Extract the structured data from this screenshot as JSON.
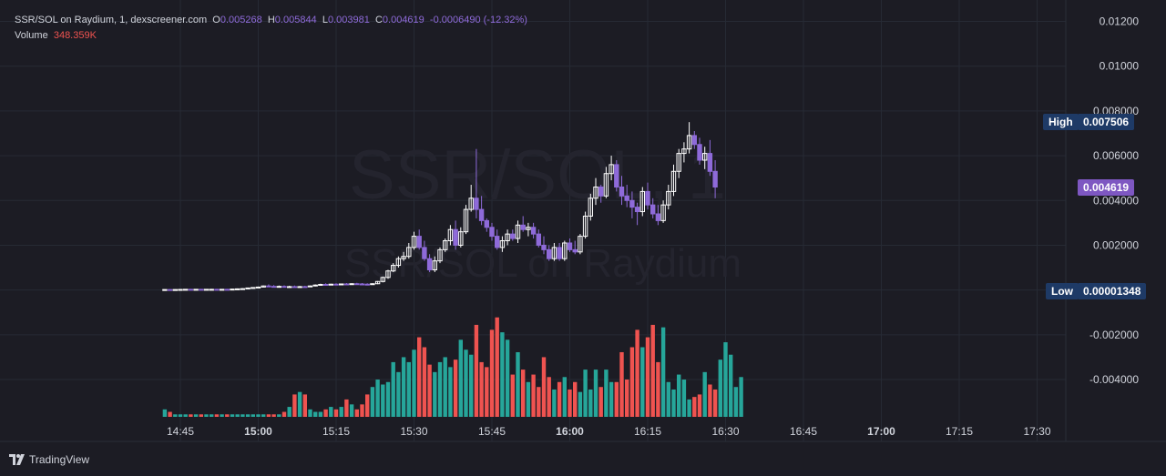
{
  "header": {
    "symbol": "SSR/SOL on Raydium, 1, dexscreener.com",
    "open_key": "O",
    "open": "0.005268",
    "high_key": "H",
    "high": "0.005844",
    "low_key": "L",
    "low": "0.003981",
    "close_key": "C",
    "close": "0.004619",
    "change": "-0.0006490 (-12.32%)",
    "volume_label": "Volume",
    "volume": "348.359K"
  },
  "watermark": {
    "line1": "SSR/SOL, 1",
    "line2": "SSR/SOL on Raydium"
  },
  "tags": {
    "high_label": "High",
    "high_value": "0.007506",
    "low_label": "Low",
    "low_value": "0.00001348",
    "last_value": "0.004619"
  },
  "branding": {
    "name": "TradingView"
  },
  "colors": {
    "background": "#1c1c24",
    "up_candle": "#ffffff",
    "down_candle": "#8e6ad9",
    "volume_up": "#26a69a",
    "volume_down": "#ef5350",
    "last_price_tag": "#7e57c2",
    "high_low_tag": "#1e3a66"
  },
  "chart_data": {
    "type": "candlestick",
    "price_axis": {
      "tick_labels": [
        "0.01200",
        "0.01000",
        "0.008000",
        "0.006000",
        "0.004000",
        "0.002000",
        "-0.002000",
        "-0.004000"
      ],
      "tick_values": [
        0.012,
        0.01,
        0.008,
        0.006,
        0.004,
        0.002,
        -0.002,
        -0.004
      ],
      "range": [
        -0.0057,
        0.0126
      ]
    },
    "time_axis": {
      "tick_labels": [
        "14:45",
        "15:00",
        "15:15",
        "15:30",
        "15:45",
        "16:00",
        "16:15",
        "16:30",
        "16:45",
        "17:00",
        "17:15",
        "17:30"
      ],
      "bold_labels": [
        "15:00",
        "16:00",
        "17:00"
      ],
      "start_minute": 882,
      "minutes_per_candle": 1
    },
    "candles_ohlc": [
      [
        1.35e-05,
        2.5e-05,
        1.35e-05,
        2e-05
      ],
      [
        2e-05,
        3.5e-05,
        1e-05,
        1.5e-05
      ],
      [
        1.5e-05,
        3e-05,
        1e-05,
        2e-05
      ],
      [
        2e-05,
        4e-05,
        1.5e-05,
        2.5e-05
      ],
      [
        2.5e-05,
        4e-05,
        2e-05,
        3e-05
      ],
      [
        3e-05,
        5e-05,
        2e-05,
        2e-05
      ],
      [
        2e-05,
        4e-05,
        1.5e-05,
        3e-05
      ],
      [
        3e-05,
        5e-05,
        2e-05,
        2e-05
      ],
      [
        2e-05,
        4e-05,
        1.5e-05,
        3e-05
      ],
      [
        3e-05,
        5e-05,
        2e-05,
        3e-05
      ],
      [
        3e-05,
        5e-05,
        2e-05,
        2e-05
      ],
      [
        2e-05,
        4e-05,
        1.5e-05,
        3e-05
      ],
      [
        3e-05,
        5e-05,
        2e-05,
        2e-05
      ],
      [
        2e-05,
        5e-05,
        1.5e-05,
        4e-05
      ],
      [
        4e-05,
        7e-05,
        3e-05,
        5e-05
      ],
      [
        5e-05,
        8e-05,
        4e-05,
        6e-05
      ],
      [
        6e-05,
        0.0001,
        5e-05,
        9e-05
      ],
      [
        9e-05,
        0.00012,
        8e-05,
        0.00011
      ],
      [
        0.00011,
        0.00015,
        0.0001,
        0.00013
      ],
      [
        0.00013,
        0.0002,
        0.00012,
        0.00018
      ],
      [
        0.00018,
        0.00025,
        0.00014,
        0.00016
      ],
      [
        0.00016,
        0.00022,
        0.00014,
        0.00015
      ],
      [
        0.00015,
        0.0002,
        0.00013,
        0.00016
      ],
      [
        0.00016,
        0.00021,
        0.00014,
        0.00014
      ],
      [
        0.00014,
        0.00019,
        0.00012,
        0.00015
      ],
      [
        0.00015,
        0.0002,
        0.00013,
        0.00014
      ],
      [
        0.00014,
        0.00018,
        0.00012,
        0.00015
      ],
      [
        0.00015,
        0.00019,
        0.00013,
        0.00014
      ],
      [
        0.00014,
        0.0002,
        0.00013,
        0.00018
      ],
      [
        0.00018,
        0.00025,
        0.00016,
        0.00022
      ],
      [
        0.00022,
        0.00028,
        0.0002,
        0.00025
      ],
      [
        0.00025,
        0.0003,
        0.00022,
        0.00024
      ],
      [
        0.00024,
        0.00028,
        0.00022,
        0.00026
      ],
      [
        0.00026,
        0.0003,
        0.00024,
        0.00025
      ],
      [
        0.00025,
        0.00029,
        0.00023,
        0.00027
      ],
      [
        0.00027,
        0.00031,
        0.00025,
        0.00026
      ],
      [
        0.00026,
        0.0003,
        0.00024,
        0.00028
      ],
      [
        0.00028,
        0.00032,
        0.00026,
        0.00027
      ],
      [
        0.00027,
        0.00031,
        0.00025,
        0.00026
      ],
      [
        0.00026,
        0.0003,
        0.00024,
        0.00025
      ],
      [
        0.00025,
        0.0003,
        0.00023,
        0.00028
      ],
      [
        0.00028,
        0.0004,
        0.00026,
        0.00038
      ],
      [
        0.00038,
        0.0006,
        0.00034,
        0.00056
      ],
      [
        0.00056,
        0.0009,
        0.0005,
        0.00085
      ],
      [
        0.00085,
        0.0012,
        0.0008,
        0.0011
      ],
      [
        0.0011,
        0.0015,
        0.001,
        0.0014
      ],
      [
        0.0014,
        0.0017,
        0.0013,
        0.0015
      ],
      [
        0.0015,
        0.0021,
        0.0014,
        0.0019
      ],
      [
        0.0019,
        0.0026,
        0.0018,
        0.0024
      ],
      [
        0.0024,
        0.0027,
        0.0018,
        0.0019
      ],
      [
        0.0019,
        0.0022,
        0.0013,
        0.0014
      ],
      [
        0.0014,
        0.0016,
        0.0008,
        0.0009
      ],
      [
        0.0009,
        0.0015,
        0.0008,
        0.0013
      ],
      [
        0.0013,
        0.0019,
        0.0012,
        0.0018
      ],
      [
        0.0018,
        0.0023,
        0.0017,
        0.0022
      ],
      [
        0.0022,
        0.0029,
        0.002,
        0.0027
      ],
      [
        0.0027,
        0.0031,
        0.0018,
        0.002
      ],
      [
        0.002,
        0.0028,
        0.0019,
        0.0026
      ],
      [
        0.0026,
        0.0038,
        0.0025,
        0.0036
      ],
      [
        0.0036,
        0.0047,
        0.0035,
        0.0041
      ],
      [
        0.0041,
        0.0063,
        0.0032,
        0.0036
      ],
      [
        0.0036,
        0.0042,
        0.0029,
        0.0031
      ],
      [
        0.0031,
        0.0032,
        0.0026,
        0.0028
      ],
      [
        0.0028,
        0.003,
        0.0022,
        0.0024
      ],
      [
        0.0024,
        0.0027,
        0.0018,
        0.0019
      ],
      [
        0.0019,
        0.0024,
        0.0017,
        0.0022
      ],
      [
        0.0022,
        0.0027,
        0.002,
        0.0025
      ],
      [
        0.0025,
        0.0027,
        0.0022,
        0.0023
      ],
      [
        0.0023,
        0.0031,
        0.0021,
        0.0029
      ],
      [
        0.0029,
        0.0033,
        0.0026,
        0.0027
      ],
      [
        0.0027,
        0.003,
        0.0024,
        0.0028
      ],
      [
        0.0028,
        0.003,
        0.0023,
        0.0025
      ],
      [
        0.0025,
        0.0027,
        0.0019,
        0.002
      ],
      [
        0.002,
        0.0024,
        0.0016,
        0.0018
      ],
      [
        0.0018,
        0.002,
        0.0013,
        0.0014
      ],
      [
        0.0014,
        0.0021,
        0.0013,
        0.0019
      ],
      [
        0.0019,
        0.0021,
        0.0013,
        0.0014
      ],
      [
        0.0014,
        0.0022,
        0.0013,
        0.0021
      ],
      [
        0.0021,
        0.0023,
        0.0017,
        0.0018
      ],
      [
        0.0018,
        0.0022,
        0.0016,
        0.0017
      ],
      [
        0.0017,
        0.0025,
        0.0016,
        0.0024
      ],
      [
        0.0024,
        0.0035,
        0.0023,
        0.0033
      ],
      [
        0.0033,
        0.0043,
        0.0031,
        0.0041
      ],
      [
        0.0041,
        0.005,
        0.0038,
        0.0046
      ],
      [
        0.0046,
        0.0047,
        0.0039,
        0.0042
      ],
      [
        0.0042,
        0.0055,
        0.0041,
        0.0052
      ],
      [
        0.0052,
        0.006,
        0.0049,
        0.0056
      ],
      [
        0.0056,
        0.0058,
        0.0044,
        0.0046
      ],
      [
        0.0046,
        0.0051,
        0.0038,
        0.0042
      ],
      [
        0.0042,
        0.0047,
        0.0037,
        0.004
      ],
      [
        0.004,
        0.0044,
        0.0032,
        0.0037
      ],
      [
        0.0037,
        0.0039,
        0.0029,
        0.0035
      ],
      [
        0.0035,
        0.0046,
        0.0033,
        0.0044
      ],
      [
        0.0044,
        0.0048,
        0.0036,
        0.0038
      ],
      [
        0.0038,
        0.0041,
        0.0032,
        0.0034
      ],
      [
        0.0034,
        0.0038,
        0.0029,
        0.0031
      ],
      [
        0.0031,
        0.004,
        0.003,
        0.0038
      ],
      [
        0.0038,
        0.0047,
        0.0036,
        0.0044
      ],
      [
        0.0044,
        0.0056,
        0.0042,
        0.0053
      ],
      [
        0.0053,
        0.0063,
        0.005,
        0.0061
      ],
      [
        0.0061,
        0.0066,
        0.0057,
        0.0063
      ],
      [
        0.0063,
        0.0075,
        0.0061,
        0.0069
      ],
      [
        0.0069,
        0.0071,
        0.0063,
        0.0065
      ],
      [
        0.0065,
        0.0068,
        0.0056,
        0.0058
      ],
      [
        0.0058,
        0.0064,
        0.0054,
        0.0061
      ],
      [
        0.0061,
        0.0067,
        0.0051,
        0.0053
      ],
      [
        0.0053,
        0.0058,
        0.0041,
        0.0046
      ]
    ],
    "volume": [
      300,
      200,
      100,
      100,
      100,
      100,
      100,
      100,
      100,
      100,
      100,
      100,
      100,
      100,
      100,
      100,
      100,
      100,
      100,
      100,
      100,
      100,
      100,
      200,
      400,
      900,
      1000,
      900,
      300,
      200,
      200,
      300,
      400,
      300,
      400,
      700,
      500,
      300,
      500,
      900,
      1200,
      1500,
      1300,
      1400,
      2200,
      1800,
      2400,
      2200,
      2700,
      3200,
      2800,
      2100,
      1800,
      2200,
      2400,
      2000,
      2300,
      3100,
      2700,
      2500,
      3700,
      2200,
      2000,
      3500,
      4000,
      3400,
      3100,
      1700,
      2600,
      1900,
      1400,
      1700,
      1200,
      2400,
      1600,
      1100,
      1400,
      1600,
      1100,
      1400,
      1000,
      1900,
      1100,
      1900,
      1200,
      1900,
      1400,
      1400,
      2600,
      1500,
      2800,
      3500,
      2800,
      3200,
      3700,
      2200,
      3600,
      1400,
      1100,
      1700,
      1500,
      700,
      800,
      900,
      1800,
      1300,
      1100,
      2300,
      3000,
      2500,
      1200,
      1600
    ],
    "volume_scale_max": 4100
  }
}
